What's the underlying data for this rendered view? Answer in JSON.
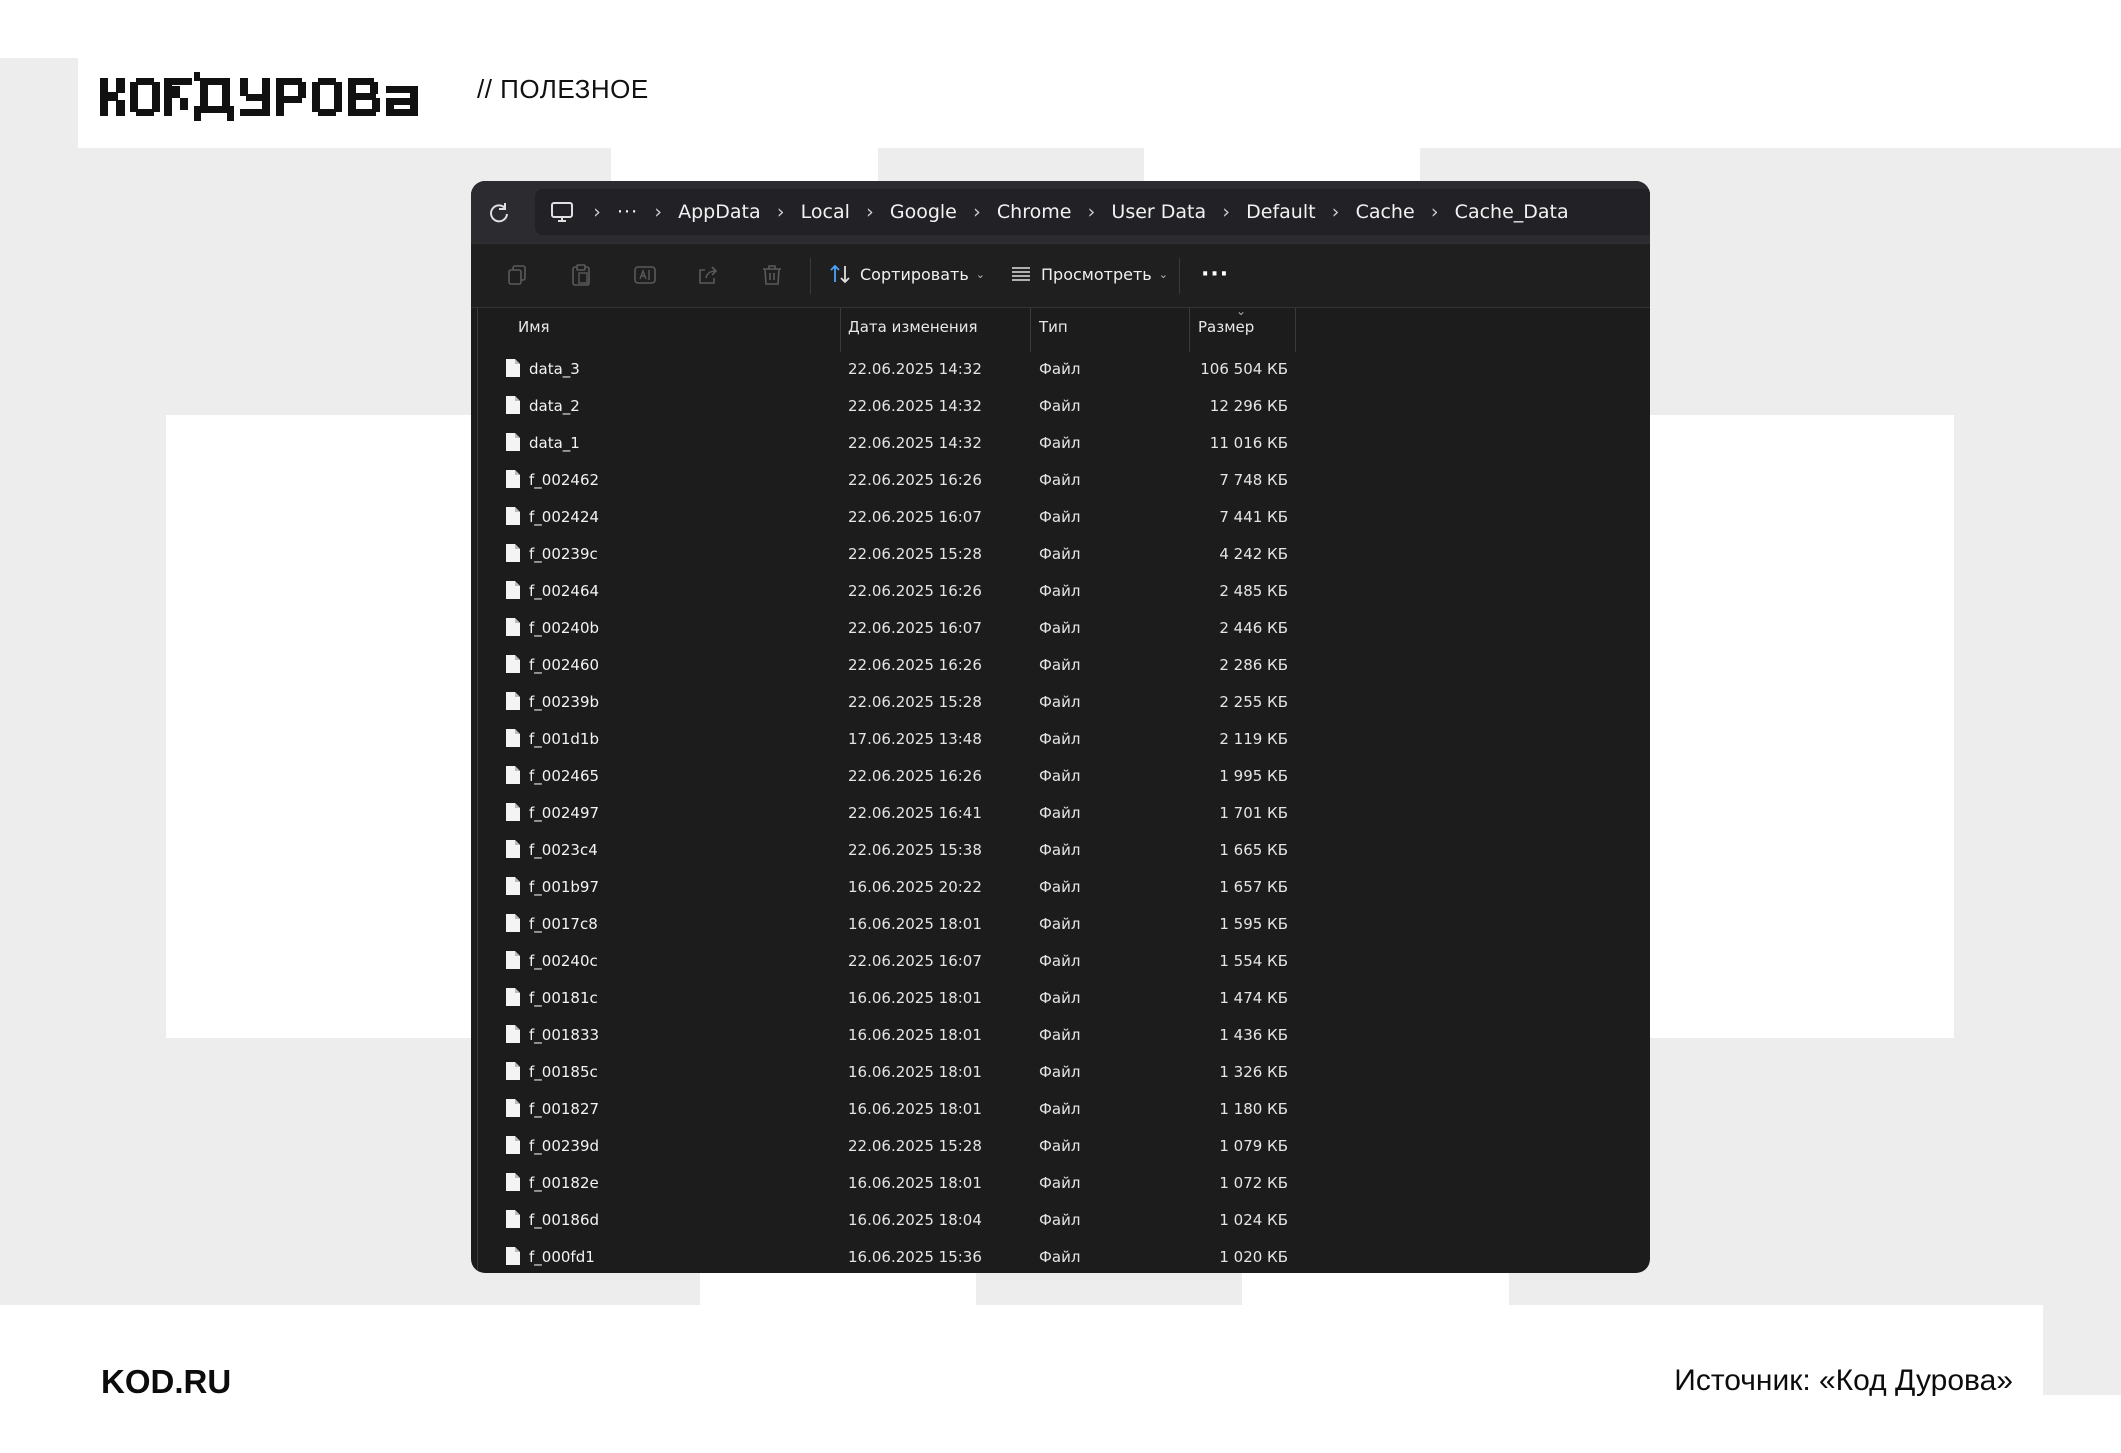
{
  "brand": {
    "logo_text": "КОДДУРОВА",
    "tag": "// ПОЛЕЗНОЕ",
    "footer_site": "KOD.RU",
    "footer_source": "Источник: «Код Дурова»"
  },
  "explorer": {
    "breadcrumbs": [
      "AppData",
      "Local",
      "Google",
      "Chrome",
      "User Data",
      "Default",
      "Cache",
      "Cache_Data"
    ],
    "toolbar": {
      "sort_label": "Сортировать",
      "view_label": "Просмотреть",
      "more_label": "···"
    },
    "columns": {
      "name": "Имя",
      "date": "Дата изменения",
      "type": "Тип",
      "size": "Размер"
    },
    "files": [
      {
        "name": "data_3",
        "date": "22.06.2025 14:32",
        "type": "Файл",
        "size": "106 504 КБ"
      },
      {
        "name": "data_2",
        "date": "22.06.2025 14:32",
        "type": "Файл",
        "size": "12 296 КБ"
      },
      {
        "name": "data_1",
        "date": "22.06.2025 14:32",
        "type": "Файл",
        "size": "11 016 КБ"
      },
      {
        "name": "f_002462",
        "date": "22.06.2025 16:26",
        "type": "Файл",
        "size": "7 748 КБ"
      },
      {
        "name": "f_002424",
        "date": "22.06.2025 16:07",
        "type": "Файл",
        "size": "7 441 КБ"
      },
      {
        "name": "f_00239c",
        "date": "22.06.2025 15:28",
        "type": "Файл",
        "size": "4 242 КБ"
      },
      {
        "name": "f_002464",
        "date": "22.06.2025 16:26",
        "type": "Файл",
        "size": "2 485 КБ"
      },
      {
        "name": "f_00240b",
        "date": "22.06.2025 16:07",
        "type": "Файл",
        "size": "2 446 КБ"
      },
      {
        "name": "f_002460",
        "date": "22.06.2025 16:26",
        "type": "Файл",
        "size": "2 286 КБ"
      },
      {
        "name": "f_00239b",
        "date": "22.06.2025 15:28",
        "type": "Файл",
        "size": "2 255 КБ"
      },
      {
        "name": "f_001d1b",
        "date": "17.06.2025 13:48",
        "type": "Файл",
        "size": "2 119 КБ"
      },
      {
        "name": "f_002465",
        "date": "22.06.2025 16:26",
        "type": "Файл",
        "size": "1 995 КБ"
      },
      {
        "name": "f_002497",
        "date": "22.06.2025 16:41",
        "type": "Файл",
        "size": "1 701 КБ"
      },
      {
        "name": "f_0023c4",
        "date": "22.06.2025 15:38",
        "type": "Файл",
        "size": "1 665 КБ"
      },
      {
        "name": "f_001b97",
        "date": "16.06.2025 20:22",
        "type": "Файл",
        "size": "1 657 КБ"
      },
      {
        "name": "f_0017c8",
        "date": "16.06.2025 18:01",
        "type": "Файл",
        "size": "1 595 КБ"
      },
      {
        "name": "f_00240c",
        "date": "22.06.2025 16:07",
        "type": "Файл",
        "size": "1 554 КБ"
      },
      {
        "name": "f_00181c",
        "date": "16.06.2025 18:01",
        "type": "Файл",
        "size": "1 474 КБ"
      },
      {
        "name": "f_001833",
        "date": "16.06.2025 18:01",
        "type": "Файл",
        "size": "1 436 КБ"
      },
      {
        "name": "f_00185c",
        "date": "16.06.2025 18:01",
        "type": "Файл",
        "size": "1 326 КБ"
      },
      {
        "name": "f_001827",
        "date": "16.06.2025 18:01",
        "type": "Файл",
        "size": "1 180 КБ"
      },
      {
        "name": "f_00239d",
        "date": "22.06.2025 15:28",
        "type": "Файл",
        "size": "1 079 КБ"
      },
      {
        "name": "f_00182e",
        "date": "16.06.2025 18:01",
        "type": "Файл",
        "size": "1 072 КБ"
      },
      {
        "name": "f_00186d",
        "date": "16.06.2025 18:04",
        "type": "Файл",
        "size": "1 024 КБ"
      },
      {
        "name": "f_000fd1",
        "date": "16.06.2025 15:36",
        "type": "Файл",
        "size": "1 020 КБ"
      }
    ]
  },
  "colors": {
    "window_bg": "#1c1c1c",
    "address_bar": "#2b2b30",
    "accent_sort": "#4aa3ff"
  }
}
